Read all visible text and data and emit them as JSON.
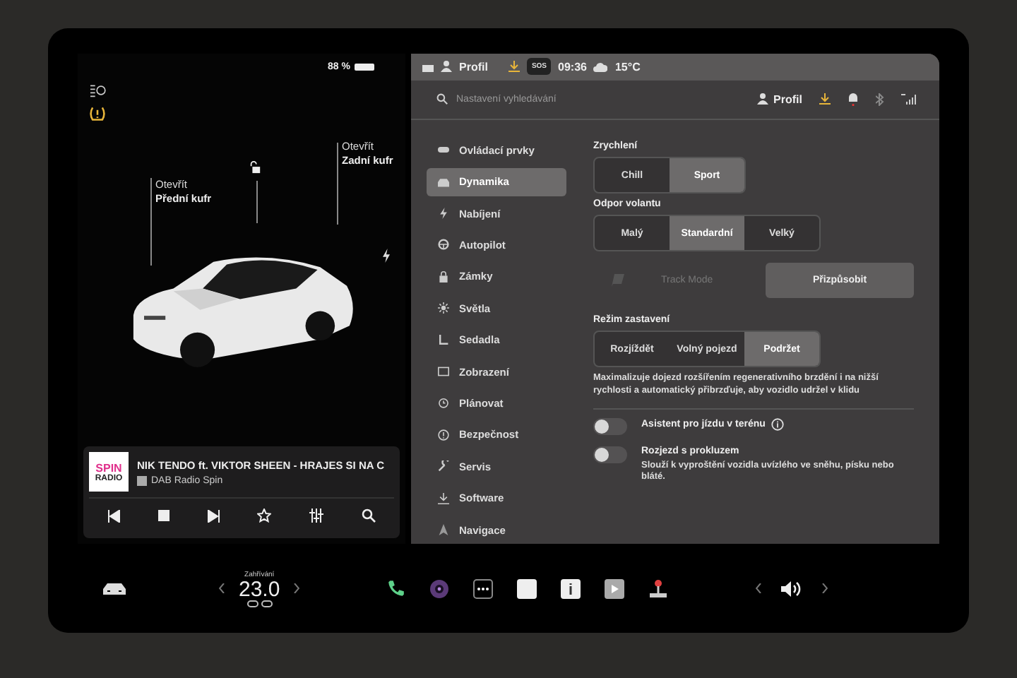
{
  "car_panel": {
    "battery": "88 %",
    "frunk": {
      "action": "Otevřít",
      "label": "Přední kufr"
    },
    "trunk": {
      "action": "Otevřít",
      "label": "Zadní kufr"
    }
  },
  "media": {
    "logo_top": "SPIN",
    "logo_bottom": "RADIO",
    "title": "NIK TENDO ft. VIKTOR SHEEN - HRAJES SI NA C",
    "source": "DAB Radio Spin"
  },
  "status_bar": {
    "profile": "Profil",
    "sos": "SOS",
    "time": "09:36",
    "temperature": "15°C"
  },
  "header": {
    "search": {
      "placeholder": "Nastavení vyhledávání"
    },
    "profile": "Profil"
  },
  "menu": [
    {
      "label": "Ovládací prvky",
      "selected": false
    },
    {
      "label": "Dynamika",
      "selected": true
    },
    {
      "label": "Nabíjení",
      "selected": false
    },
    {
      "label": "Autopilot",
      "selected": false
    },
    {
      "label": "Zámky",
      "selected": false
    },
    {
      "label": "Světla",
      "selected": false
    },
    {
      "label": "Sedadla",
      "selected": false
    },
    {
      "label": "Zobrazení",
      "selected": false
    },
    {
      "label": "Plánovat",
      "selected": false
    },
    {
      "label": "Bezpečnost",
      "selected": false
    },
    {
      "label": "Servis",
      "selected": false
    },
    {
      "label": "Software",
      "selected": false
    },
    {
      "label": "Navigace",
      "selected": false
    }
  ],
  "acceleration": {
    "title": "Zrychlení",
    "options": [
      {
        "label": "Chill",
        "selected": false
      },
      {
        "label": "Sport",
        "selected": true
      }
    ]
  },
  "steering": {
    "title": "Odpor volantu",
    "options": [
      {
        "label": "Malý",
        "selected": false
      },
      {
        "label": "Standardní",
        "selected": true
      },
      {
        "label": "Velký",
        "selected": false
      }
    ]
  },
  "track_mode": {
    "label": "Track Mode",
    "button": "Přizpůsobit"
  },
  "stopping": {
    "title": "Režim zastavení",
    "options": [
      {
        "label": "Rozjíždět",
        "selected": false
      },
      {
        "label": "Volný pojezd",
        "selected": false
      },
      {
        "label": "Podržet",
        "selected": true
      }
    ],
    "description": "Maximalizuje dojezd rozšířením regenerativního brzdění i na nižší rychlosti a automatický přibrzďuje, aby vozidlo udržel v klidu"
  },
  "toggles": [
    {
      "label": "Asistent pro jízdu v terénu",
      "on": false,
      "info": true
    },
    {
      "label": "Rozjezd s prokluzem",
      "on": false,
      "info": false,
      "description": "Slouží k vyproštění vozidla uvízlého ve sněhu, písku nebo bláté."
    }
  ],
  "dock": {
    "climate_label": "Zahřívání",
    "temperature": "23.0"
  }
}
